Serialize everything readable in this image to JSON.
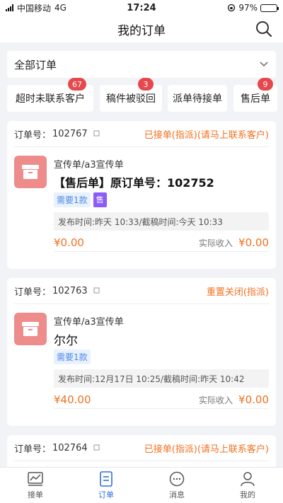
{
  "status_bar": {
    "carrier": "中国移动",
    "network": "4G",
    "time": "17:24",
    "battery_text": "97%",
    "battery_level": 0.97
  },
  "header": {
    "title": "我的订单"
  },
  "filter": {
    "selected": "全部订单"
  },
  "chips": [
    {
      "label": "超时未联系客户",
      "badge": "67"
    },
    {
      "label": "稿件被驳回",
      "badge": "3"
    },
    {
      "label": "派单待接单",
      "badge": ""
    },
    {
      "label": "售后单",
      "badge": "9"
    }
  ],
  "orders": [
    {
      "order_label": "订单号：",
      "order_no": "102767",
      "status": "已接单(指派)(请马上联系客户)",
      "type": "宣传单/a3宣传单",
      "title": "【售后单】原订单号：102752",
      "tag": "需要1款",
      "sale_tag": "售",
      "times": "发布时间:昨天 10:33/截稿时间:今天 10:33",
      "price": "¥0.00",
      "income_label": "实际收入",
      "income": "¥0.00"
    },
    {
      "order_label": "订单号：",
      "order_no": "102763",
      "status": "重置关闭(指派)",
      "type": "宣传单/a3宣传单",
      "title": "尔尔",
      "tag": "需要1款",
      "sale_tag": "",
      "times": "发布时间:12月17日 10:25/截稿时间:昨天 10:42",
      "price": "¥40.00",
      "income_label": "实际收入",
      "income": "¥0.00"
    },
    {
      "order_label": "订单号：",
      "order_no": "102764",
      "status": "已接单(指派)(请马上联系客户)"
    }
  ],
  "tabs": [
    {
      "label": "接单",
      "icon": "chart-icon"
    },
    {
      "label": "订单",
      "icon": "order-icon"
    },
    {
      "label": "消息",
      "icon": "chat-icon"
    },
    {
      "label": "我的",
      "icon": "user-icon"
    }
  ],
  "colors": {
    "accent": "#2f6fe0",
    "orange": "#f2701f",
    "badge": "#e5484d",
    "thumb": "#ee8b8b"
  }
}
